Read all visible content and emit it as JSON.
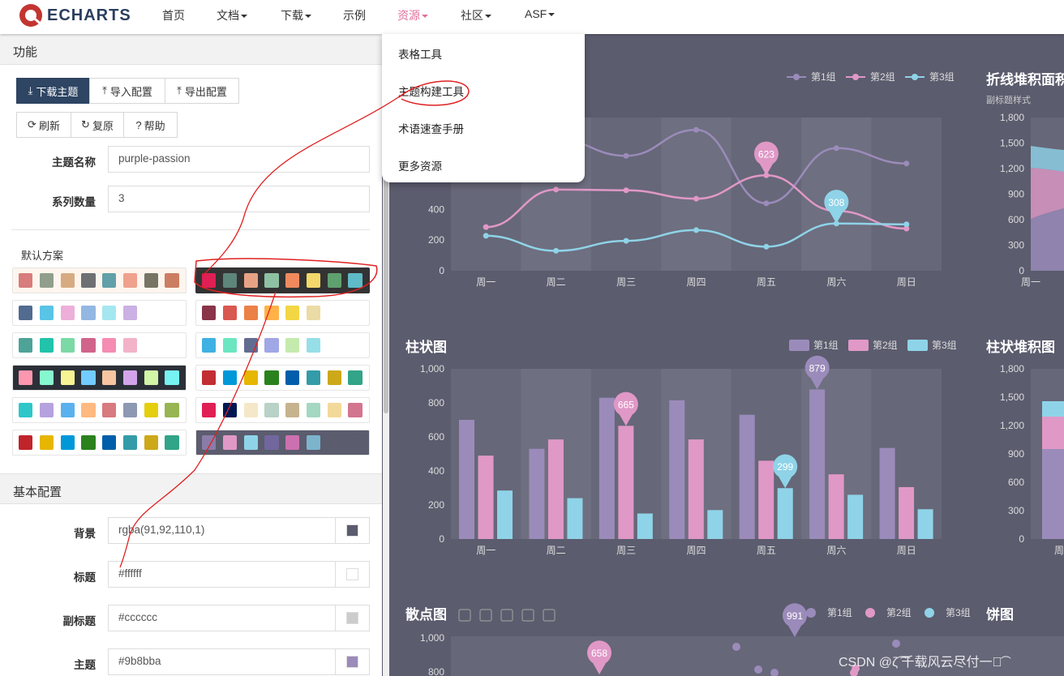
{
  "nav": {
    "logo": "ECHARTS",
    "items": [
      {
        "label": "首页",
        "caret": false
      },
      {
        "label": "文档",
        "caret": true
      },
      {
        "label": "下载",
        "caret": true
      },
      {
        "label": "示例",
        "caret": false
      },
      {
        "label": "资源",
        "caret": true,
        "active": true
      },
      {
        "label": "社区",
        "caret": true
      },
      {
        "label": "ASF",
        "caret": true
      }
    ]
  },
  "menu": [
    "表格工具",
    "主题构建工具",
    "术语速查手册",
    "更多资源"
  ],
  "left": {
    "section1": "功能",
    "buttons1": [
      "下载主题",
      "导入配置",
      "导出配置"
    ],
    "buttons2": [
      "刷新",
      "复原",
      "帮助"
    ],
    "theme_name_label": "主题名称",
    "theme_name": "purple-passion",
    "series_count_label": "系列数量",
    "series_count": "3",
    "default_label": "默认方案",
    "section2": "基本配置",
    "fields": [
      {
        "label": "背景",
        "value": "rgba(91,92,110,1)",
        "color": "#5b5c6e"
      },
      {
        "label": "标题",
        "value": "#ffffff",
        "color": "#ffffff"
      },
      {
        "label": "副标题",
        "value": "#cccccc",
        "color": "#cccccc"
      },
      {
        "label": "主题",
        "value": "#9b8bba",
        "color": "#9b8bba"
      }
    ]
  },
  "palettes": [
    {
      "bg": "#fdf5ee",
      "colors": [
        "#d87c7c",
        "#919e8b",
        "#d7ab82",
        "#6e7074",
        "#61a0a8",
        "#efa18d",
        "#787464",
        "#cc7e63"
      ]
    },
    {
      "bg": "#333333",
      "colors": [
        "#e01f54",
        "#5e8579",
        "#e7a286",
        "#8ec1a3",
        "#f08a5d",
        "#f4d86b",
        "#5fa06f",
        "#5ebbc7"
      ],
      "selected": true
    },
    {
      "bg": "#ffffff",
      "colors": [
        "#516b91",
        "#59c4e6",
        "#edafda",
        "#93b7e3",
        "#a5e7f0",
        "#cbb0e3",
        "#ffffff",
        "#ffffff"
      ]
    },
    {
      "bg": "#ffffff",
      "colors": [
        "#893448",
        "#d95850",
        "#eb8146",
        "#ffb248",
        "#f2d643",
        "#ebdba4",
        "#ffffff",
        "#ffffff"
      ]
    },
    {
      "bg": "#ffffff",
      "colors": [
        "#4ea397",
        "#22c3aa",
        "#7bd9a5",
        "#d0648a",
        "#f58db2",
        "#f2b3c9",
        "#ffffff",
        "#ffffff"
      ]
    },
    {
      "bg": "#ffffff",
      "colors": [
        "#3fb1e3",
        "#6be6c1",
        "#626c91",
        "#a0a7e6",
        "#c4ebad",
        "#96dee8",
        "#ffffff",
        "#ffffff"
      ]
    },
    {
      "bg": "#2b3038",
      "colors": [
        "#fc97af",
        "#87f7cf",
        "#f7f494",
        "#72ccff",
        "#f7c5a0",
        "#d4a4eb",
        "#d2f5a6",
        "#76f2f2"
      ]
    },
    {
      "bg": "#ffffff",
      "colors": [
        "#c12e34",
        "#0098d9",
        "#e6b600",
        "#2b821d",
        "#005eaa",
        "#339ca8",
        "#cda819",
        "#32a487"
      ]
    },
    {
      "bg": "#ffffff",
      "colors": [
        "#2ec7c9",
        "#b6a2de",
        "#5ab1ef",
        "#ffb980",
        "#d87a80",
        "#8d98b3",
        "#e5cf0d",
        "#97b552"
      ]
    },
    {
      "bg": "#ffffff",
      "colors": [
        "#e01f54",
        "#001852",
        "#f5e8c8",
        "#b8d2c7",
        "#c6b38e",
        "#a4d8c2",
        "#f3d999",
        "#d3758f"
      ]
    },
    {
      "bg": "#ffffff",
      "colors": [
        "#c1232b",
        "#e6b600",
        "#0098d9",
        "#2b821d",
        "#005eaa",
        "#339ca8",
        "#cda819",
        "#32a487"
      ]
    },
    {
      "bg": "#5b5c6e",
      "colors": [
        "#8a7ca8",
        "#e098c7",
        "#8fd3e8",
        "#71669e",
        "#cc70af",
        "#7cb4cc",
        "#5b5c6e",
        "#5b5c6e"
      ]
    }
  ],
  "colors": {
    "s1": "#9b8bba",
    "s2": "#e098c7",
    "s3": "#8fd3e8",
    "bg": "#5b5c6e"
  },
  "chart_data": [
    {
      "type": "line",
      "title": "",
      "categories": [
        "周一",
        "周二",
        "周三",
        "周四",
        "周五",
        "周六",
        "周日"
      ],
      "ylim": [
        0,
        1000
      ],
      "yticks": [
        "0",
        "200",
        "400"
      ],
      "legend": [
        "第1组",
        "第2组",
        "第3组"
      ],
      "legend_placement": "top-right",
      "series": [
        {
          "name": "第1组",
          "values": [
            880,
            860,
            750,
            920,
            440,
            800,
            700
          ]
        },
        {
          "name": "第2组",
          "values": [
            285,
            530,
            525,
            470,
            623,
            390,
            275
          ]
        },
        {
          "name": "第3组",
          "values": [
            228,
            130,
            195,
            265,
            157,
            308,
            303
          ]
        }
      ],
      "markers": [
        {
          "label": "623"
        },
        {
          "label": "308"
        }
      ]
    },
    {
      "type": "bar",
      "title": "柱状图",
      "categories": [
        "周一",
        "周二",
        "周三",
        "周四",
        "周五",
        "周六",
        "周日"
      ],
      "ylim": [
        0,
        1000
      ],
      "yticks": [
        "0",
        "200",
        "400",
        "600",
        "800",
        "1,000"
      ],
      "legend": [
        "第1组",
        "第2组",
        "第3组"
      ],
      "legend_placement": "top-right",
      "series": [
        {
          "name": "第1组",
          "values": [
            700,
            530,
            830,
            815,
            730,
            879,
            535
          ]
        },
        {
          "name": "第2组",
          "values": [
            490,
            585,
            665,
            585,
            460,
            380,
            305
          ]
        },
        {
          "name": "第3组",
          "values": [
            285,
            240,
            150,
            170,
            299,
            260,
            175
          ]
        }
      ],
      "markers": [
        {
          "label": "665"
        },
        {
          "label": "299"
        },
        {
          "label": "879"
        }
      ]
    },
    {
      "type": "area",
      "title": "折线堆积面积",
      "subtitle": "副标题样式",
      "yticks": [
        "0",
        "300",
        "600",
        "900",
        "1,200",
        "1,500",
        "1,800"
      ],
      "categories": [
        "周一"
      ]
    },
    {
      "type": "bar",
      "title": "柱状堆积图",
      "yticks": [
        "0",
        "300",
        "600",
        "900",
        "1,200",
        "1,500",
        "1,800"
      ],
      "categories": [
        "周"
      ]
    },
    {
      "type": "scatter",
      "title": "散点图",
      "legend": [
        "第1组",
        "第2组",
        "第3组"
      ],
      "legend_placement": "top-right",
      "yticks": [
        "800",
        "1,000"
      ],
      "markers": [
        {
          "label": "991"
        },
        {
          "label": "658"
        }
      ]
    },
    {
      "type": "pie",
      "title": "饼图"
    }
  ],
  "watermark": "CSDN @ζ͡ ͡千载风云尽付一笑͡"
}
